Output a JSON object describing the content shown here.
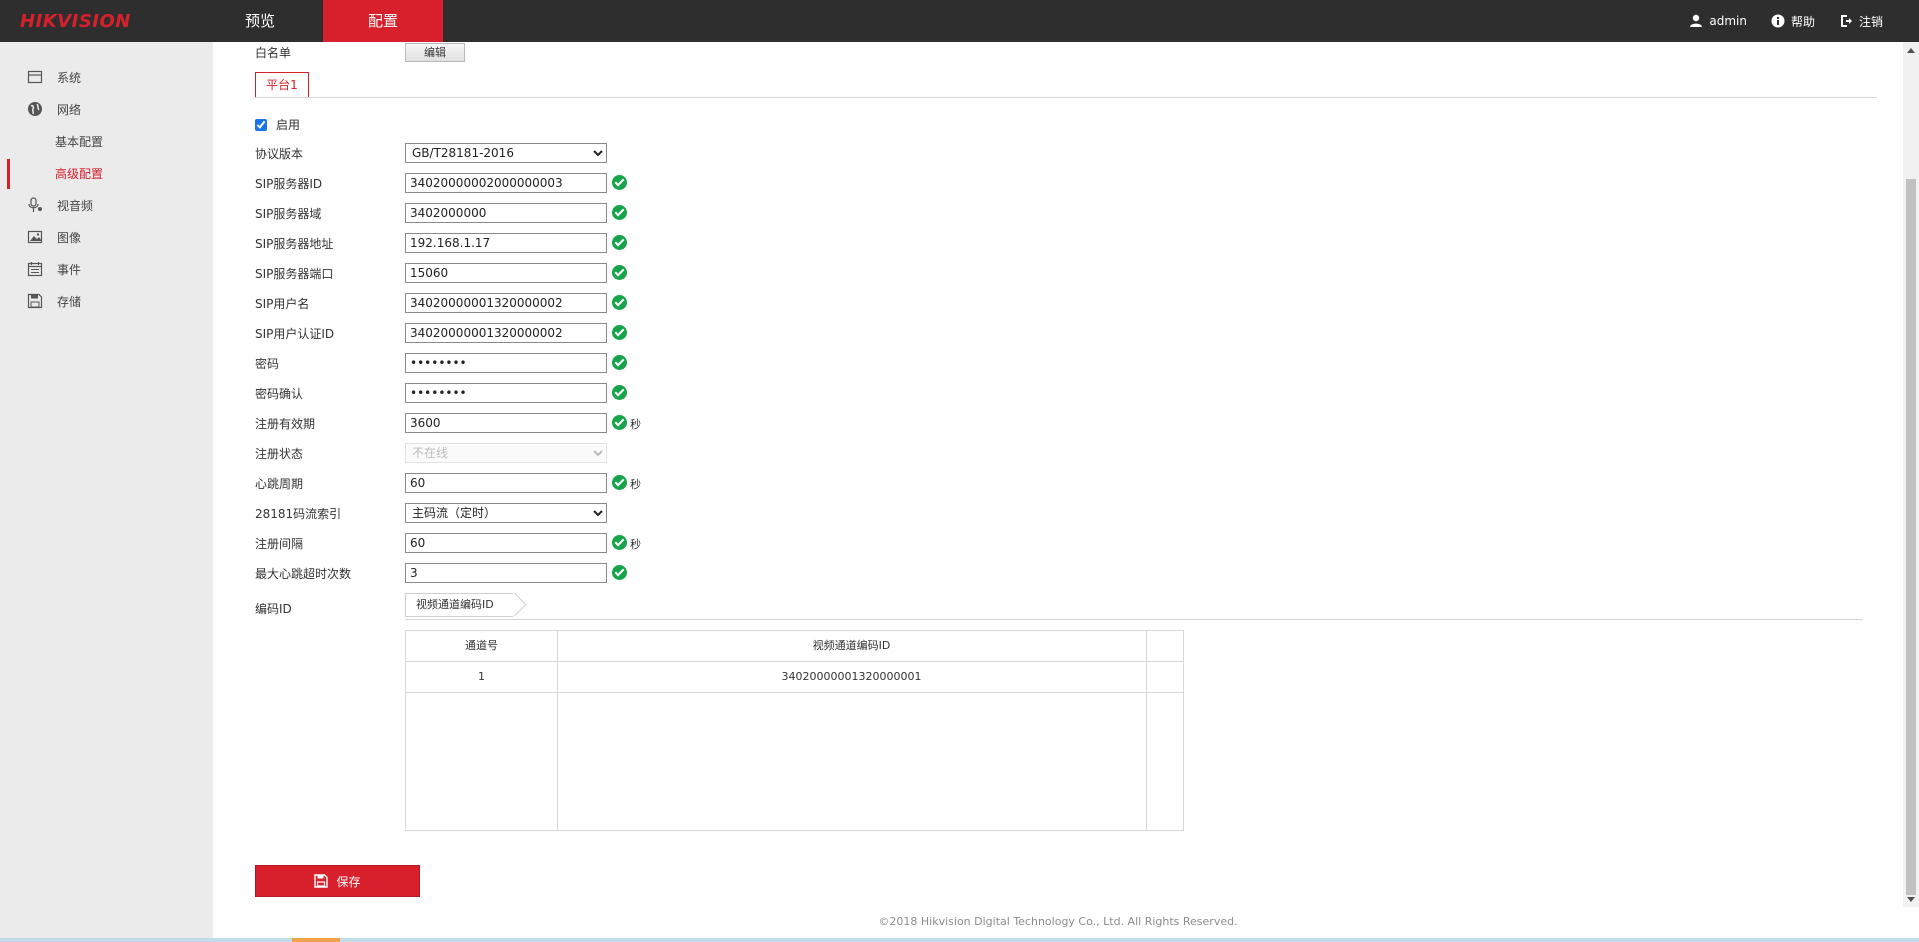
{
  "header": {
    "logo": "HIKVISION",
    "tabs": [
      {
        "label": "预览"
      },
      {
        "label": "配置"
      }
    ],
    "user": "admin",
    "help": "帮助",
    "logout": "注销"
  },
  "sidebar": {
    "items": [
      {
        "label": "系统",
        "icon": "system-icon"
      },
      {
        "label": "网络",
        "icon": "globe-icon"
      },
      {
        "label": "基本配置"
      },
      {
        "label": "高级配置"
      },
      {
        "label": "视音频",
        "icon": "mic-icon"
      },
      {
        "label": "图像",
        "icon": "image-icon"
      },
      {
        "label": "事件",
        "icon": "calendar-icon"
      },
      {
        "label": "存储",
        "icon": "save-icon"
      }
    ]
  },
  "form": {
    "whitelist_label": "白名单",
    "whitelist_button": "编辑",
    "platform_tab": "平台1",
    "enable_label": "启用",
    "enable_checked": true,
    "rows": {
      "protocol": {
        "label": "协议版本",
        "value": "GB/T28181-2016"
      },
      "sip_server_id": {
        "label": "SIP服务器ID",
        "value": "34020000002000000003"
      },
      "sip_server_domain": {
        "label": "SIP服务器域",
        "value": "3402000000"
      },
      "sip_server_address": {
        "label": "SIP服务器地址",
        "value": "192.168.1.17"
      },
      "sip_server_port": {
        "label": "SIP服务器端口",
        "value": "15060"
      },
      "sip_username": {
        "label": "SIP用户名",
        "value": "34020000001320000002"
      },
      "sip_auth_id": {
        "label": "SIP用户认证ID",
        "value": "34020000001320000002"
      },
      "password": {
        "label": "密码",
        "value": "••••••••"
      },
      "password_confirm": {
        "label": "密码确认",
        "value": "••••••••"
      },
      "register_validity": {
        "label": "注册有效期",
        "value": "3600",
        "unit": "秒"
      },
      "register_status": {
        "label": "注册状态",
        "value": "不在线"
      },
      "heartbeat_period": {
        "label": "心跳周期",
        "value": "60",
        "unit": "秒"
      },
      "stream_index": {
        "label": "28181码流索引",
        "value": "主码流（定时）"
      },
      "register_interval": {
        "label": "注册间隔",
        "value": "60",
        "unit": "秒"
      },
      "max_heartbeat_timeout": {
        "label": "最大心跳超时次数",
        "value": "3"
      }
    },
    "code_id_label": "编码ID",
    "code_tab": "视频通道编码ID",
    "table": {
      "headers": [
        "通道号",
        "视频通道编码ID"
      ],
      "rows": [
        [
          "1",
          "34020000001320000001"
        ]
      ]
    },
    "save_label": "保存"
  },
  "footer": "©2018 Hikvision Digital Technology Co., Ltd. All Rights Reserved."
}
